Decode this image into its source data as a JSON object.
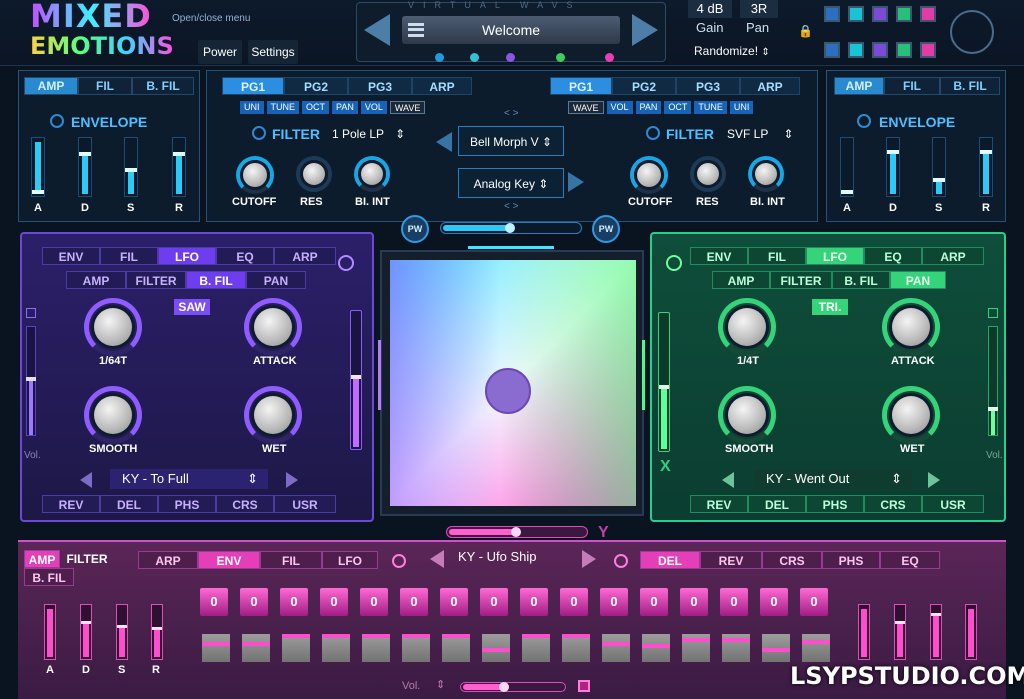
{
  "app": {
    "logo_line1": "MIXED",
    "logo_line2": "EMOTIONS",
    "open_close": "Open/close menu",
    "power": "Power",
    "settings": "Settings",
    "watermark": "LSYPSTUDIO.COM"
  },
  "preset": {
    "brand": "VIRTUAL WAVS",
    "name": "Welcome"
  },
  "header": {
    "gain_value": "4 dB",
    "gain_label": "Gain",
    "pan_value": "3R",
    "pan_label": "Pan",
    "randomize": "Randomize!"
  },
  "colors": {
    "accent_cyan": "#2ec9f5",
    "accent_purple": "#7a4df5",
    "accent_green": "#35d47a",
    "accent_magenta": "#e43fb8"
  },
  "left_env": {
    "tabs": [
      "AMP",
      "FIL",
      "B. FIL"
    ],
    "active": "AMP",
    "title": "ENVELOPE",
    "sliders": [
      "A",
      "D",
      "S",
      "R"
    ]
  },
  "right_env": {
    "tabs": [
      "AMP",
      "FIL",
      "B. FIL"
    ],
    "active": "AMP",
    "title": "ENVELOPE",
    "sliders": [
      "A",
      "D",
      "S",
      "R"
    ]
  },
  "osc_left": {
    "pages": [
      "PG1",
      "PG2",
      "PG3",
      "ARP"
    ],
    "active": "PG1",
    "subtabs": [
      "UNI",
      "TUNE",
      "OCT",
      "PAN",
      "VOL",
      "WAVE"
    ],
    "filter_label": "FILTER",
    "filter_type": "1 Pole LP",
    "knobs": [
      "CUTOFF",
      "RES",
      "BI. INT"
    ]
  },
  "osc_right": {
    "pages": [
      "PG1",
      "PG2",
      "PG3",
      "ARP"
    ],
    "active": "PG1",
    "subtabs": [
      "WAVE",
      "VOL",
      "PAN",
      "OCT",
      "TUNE",
      "UNI"
    ],
    "filter_label": "FILTER",
    "filter_type": "SVF LP",
    "knobs": [
      "CUTOFF",
      "RES",
      "BI. INT"
    ]
  },
  "center": {
    "wave1": "Bell Morph V",
    "wave2": "Analog Key",
    "nav_up": "< >",
    "nav_down": "< >",
    "pw_left": "PW",
    "pw_right": "PW"
  },
  "purple": {
    "tabs": [
      "ENV",
      "FIL",
      "LFO",
      "EQ",
      "ARP"
    ],
    "active": "LFO",
    "subtabs": [
      "AMP",
      "FILTER",
      "B. FIL",
      "PAN"
    ],
    "subactive": "B. FIL",
    "wave": "SAW",
    "knobs": [
      "1/64T",
      "ATTACK",
      "SMOOTH",
      "WET"
    ],
    "preset": "KY - To Full",
    "fx": [
      "REV",
      "DEL",
      "PHS",
      "CRS",
      "USR"
    ],
    "vol": "Vol."
  },
  "green": {
    "tabs": [
      "ENV",
      "FIL",
      "LFO",
      "EQ",
      "ARP"
    ],
    "active": "LFO",
    "subtabs": [
      "AMP",
      "FILTER",
      "B. FIL",
      "PAN"
    ],
    "subactive": "PAN",
    "wave": "TRI.",
    "knobs": [
      "1/4T",
      "ATTACK",
      "SMOOTH",
      "WET"
    ],
    "preset": "KY - Went Out",
    "fx": [
      "REV",
      "DEL",
      "PHS",
      "CRS",
      "USR"
    ],
    "vol": "Vol.",
    "x_label": "X"
  },
  "xy": {
    "y_label": "Y"
  },
  "bottom": {
    "left_tabs": [
      "AMP",
      "FILTER",
      "B. FIL"
    ],
    "active": "AMP",
    "arp_tabs": [
      "ARP",
      "ENV",
      "FIL",
      "LFO"
    ],
    "arp_active": "ENV",
    "preset": "KY - Ufo Ship",
    "fx_tabs": [
      "DEL",
      "REV",
      "CRS",
      "PHS",
      "EQ"
    ],
    "fx_active": "DEL",
    "steps": [
      "0",
      "0",
      "0",
      "0",
      "0",
      "0",
      "0",
      "0",
      "0",
      "0",
      "0",
      "0",
      "0",
      "0",
      "0",
      "0"
    ],
    "sliders": [
      "A",
      "D",
      "S",
      "R"
    ],
    "vol": "Vol."
  }
}
